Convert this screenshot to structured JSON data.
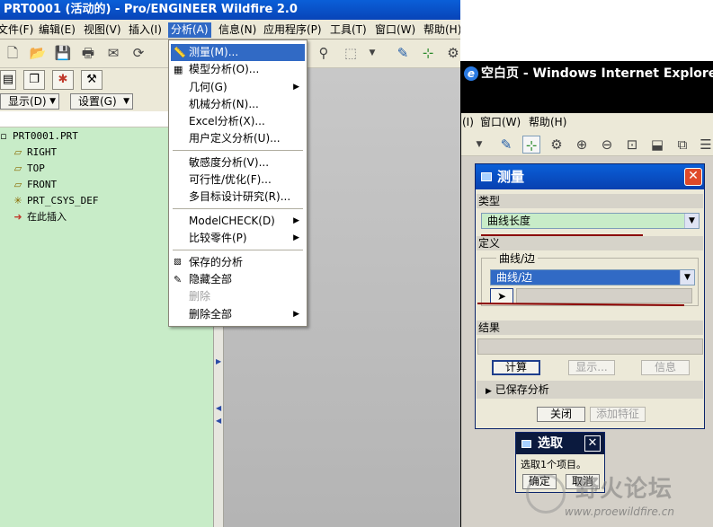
{
  "proe": {
    "title": "PRT0001 (活动的) - Pro/ENGINEER Wildfire 2.0",
    "menu": [
      "文件(F)",
      "编辑(E)",
      "视图(V)",
      "插入(I)",
      "分析(A)",
      "信息(N)",
      "应用程序(P)",
      "工具(T)",
      "窗口(W)",
      "帮助(H)"
    ],
    "display_combo": "显示(D)",
    "settings_combo": "设置(G)",
    "tree": [
      "PRT0001.PRT",
      "RIGHT",
      "TOP",
      "FRONT",
      "PRT_CSYS_DEF",
      "在此插入"
    ]
  },
  "analysis_menu": {
    "items": [
      "测量(M)...",
      "模型分析(O)...",
      "几何(G)",
      "机械分析(N)...",
      "Excel分析(X)...",
      "用户定义分析(U)...",
      "敏感度分析(V)...",
      "可行性/优化(F)...",
      "多目标设计研究(R)...",
      "ModelCHECK(D)",
      "比较零件(P)",
      "保存的分析",
      "隐藏全部",
      "删除",
      "删除全部"
    ]
  },
  "ie": {
    "title": "空白页 - Windows Internet Explorer",
    "menu": [
      "(I)",
      "窗口(W)",
      "帮助(H)"
    ]
  },
  "measure": {
    "title": "测量",
    "type_label": "类型",
    "type_value": "曲线长度",
    "definition_label": "定义",
    "group_label": "曲线/边",
    "curve_value": "曲线/边",
    "result_label": "结果",
    "compute": "计算",
    "show": "显示...",
    "info": "信息",
    "saved_analysis": "已保存分析",
    "close": "关闭",
    "add_feature": "添加特征"
  },
  "select_dialog": {
    "title": "选取",
    "message": "选取1个项目。",
    "ok": "确定",
    "cancel": "取消"
  },
  "watermark": {
    "text": "野火论坛",
    "url": "www.proewildfire.cn"
  },
  "colors": {
    "title_blue": "#0a5fd8",
    "highlight": "#316ac5",
    "tree_bg": "#c8ecc8",
    "annotation_red": "#8b0000"
  }
}
